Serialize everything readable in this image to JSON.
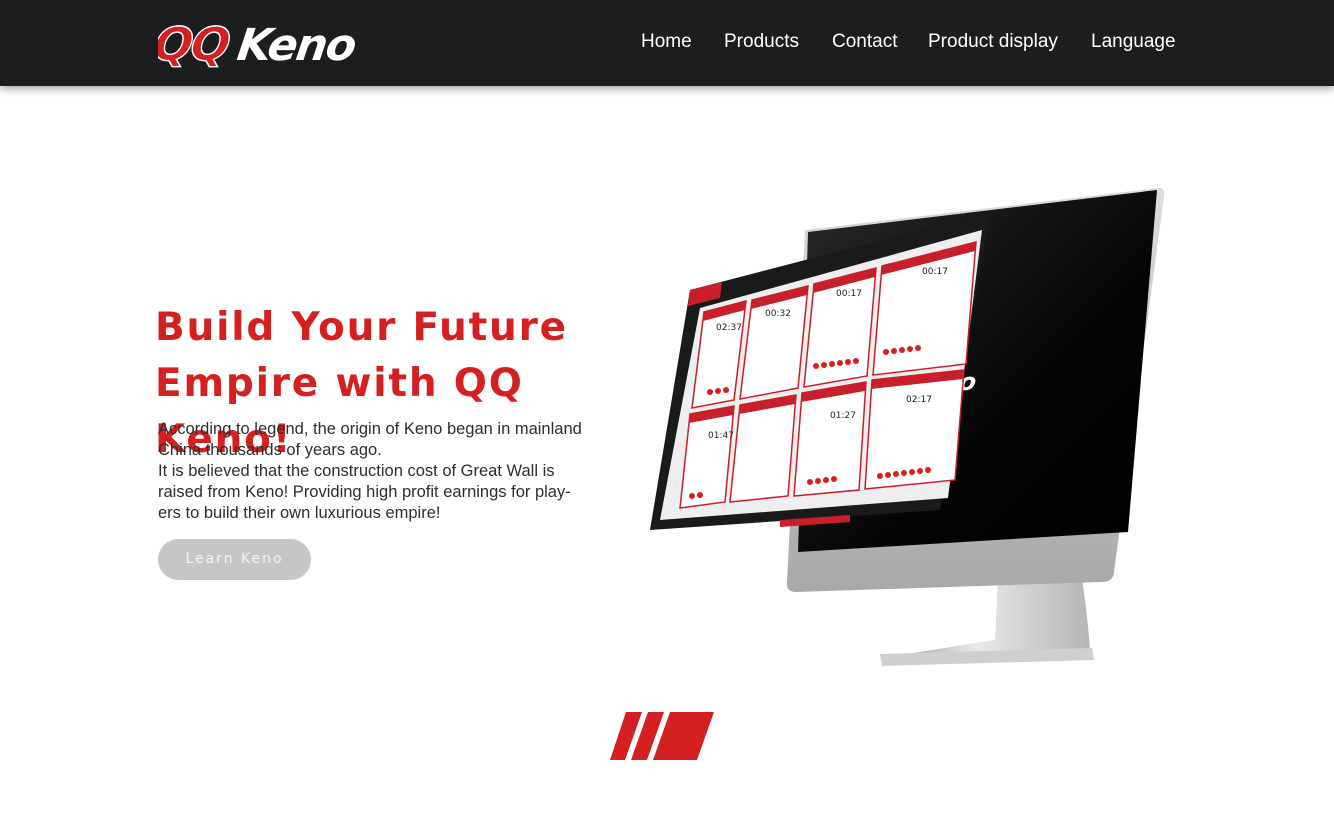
{
  "brand": {
    "logo_part1": "QQ",
    "logo_part2": "Keno"
  },
  "nav": {
    "items": [
      {
        "label": "Home"
      },
      {
        "label": "Products"
      },
      {
        "label": "Contact"
      },
      {
        "label": "Product display"
      },
      {
        "label": "Language"
      }
    ]
  },
  "hero": {
    "title_line1": "Build Your Future",
    "title_line2": "Empire with QQ Keno!",
    "desc_line1": "According to legend, the origin of Keno began in mainland",
    "desc_line2": "China thousands of years ago.",
    "desc_line3": "It is believed that the construction cost of Great Wall is",
    "desc_line4": "raised from Keno! Providing high profit earnings for play-",
    "desc_line5": "ers to build their own luxurious empire!",
    "button_label": "Learn  Keno"
  },
  "colors": {
    "accent": "#d42020",
    "topbar": "#1b1d1f",
    "button": "#c6c6c6"
  },
  "icons": {
    "decor": "red-stripes-icon",
    "device": "imac-monitor-icon"
  }
}
